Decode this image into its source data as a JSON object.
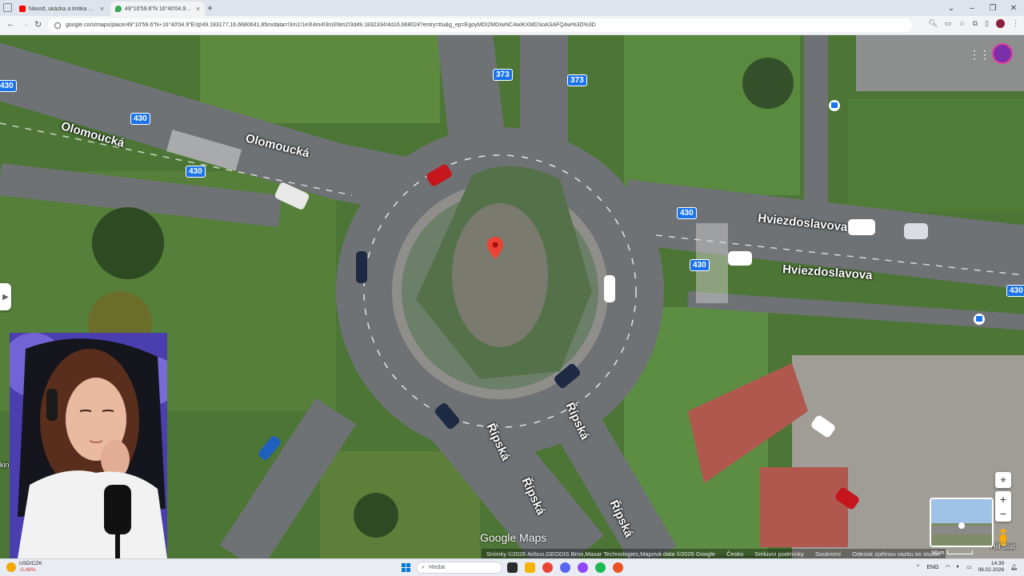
{
  "browser": {
    "tabs": [
      {
        "title": "Návod, ukázka a kritika nov",
        "favicon_color": "#ff0000",
        "active": false
      },
      {
        "title": "49°10'59.6\"N 16°40'04.9\"E - M",
        "favicon_color": "#34a853",
        "active": true
      }
    ],
    "new_tab_label": "+",
    "url": "google.com/maps/place/49°10'59.6\"N+16°40'04.9\"E/@49.183177,16.6680641,85m/data=!3m1!1e3!4m4!3m3!8m2!3d49.1832334!4d16.668024?entry=ttu&g_ep=EgoyMDI2MDIwNC4wIKXMDSoASAFQAw%3D%3D"
  },
  "map": {
    "road_labels": [
      {
        "text": "Olomoucká",
        "id": "olomoucka-1"
      },
      {
        "text": "Olomoucká",
        "id": "olomoucka-2"
      },
      {
        "text": "Hviezdoslavova",
        "id": "hviezdoslavova-1"
      },
      {
        "text": "Hviezdoslavova",
        "id": "hviezdoslavova-2"
      },
      {
        "text": "Řípská",
        "id": "ripska-1"
      },
      {
        "text": "Řípská",
        "id": "ripska-2"
      },
      {
        "text": "Řípská",
        "id": "ripska-3"
      },
      {
        "text": "Řípská",
        "id": "ripska-4"
      }
    ],
    "route_shields": [
      "430",
      "430",
      "430",
      "430",
      "430",
      "430",
      "430",
      "373",
      "373"
    ],
    "google_maps_logo": "Google Maps",
    "attribution": [
      "Snímky ©2026 Airbus,GEODIS Brno,Maxar Technologies,Mapová data ©2026 Google",
      "Česko",
      "Smluvní podmínky",
      "Soukromí",
      "Odeslat zpětnou vazbu ke službě"
    ],
    "scale_label": "10 m",
    "edge_labels": {
      "left_shield": "430",
      "right_shield": "430",
      "left_text": "kin",
      "right_text": "Hill Slat"
    }
  },
  "taskbar": {
    "ticker_symbol": "USD/CZK",
    "ticker_change": "-0,48%",
    "search_placeholder": "Hledat",
    "language": "ENG",
    "time": "14:39",
    "date": "08.02.2026"
  }
}
